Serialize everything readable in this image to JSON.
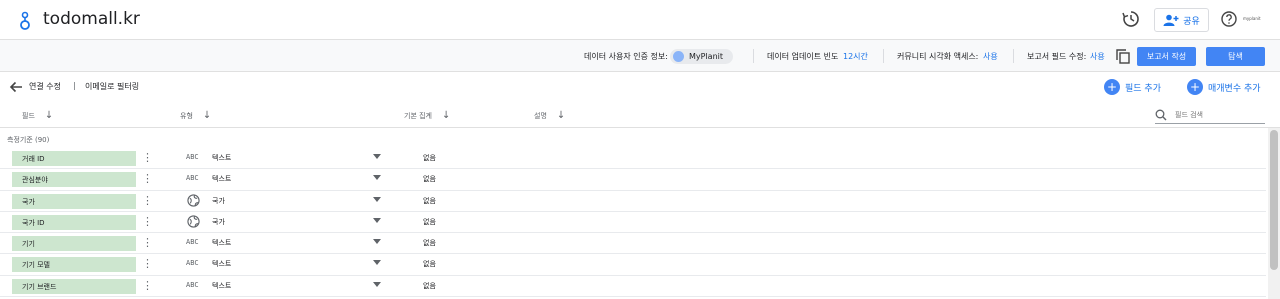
{
  "header": {
    "title": "todomall.kr",
    "share_label": "공유",
    "brand_mini": "myplanit",
    "icons": [
      "logo-icon",
      "history-icon",
      "add-person-icon",
      "help-icon"
    ]
  },
  "infobar": {
    "credentials_label": "데이터 사용자 인증 정보:",
    "credentials_user": "MyPlanit",
    "freshness_label": "데이터 업데이트 빈도",
    "freshness_value": "12시간",
    "community_label": "커뮤니티 시각화 액세스:",
    "community_value": "사용",
    "report_edit_label": "보고서 필드 수정:",
    "report_edit_value": "사용",
    "create_report_label": "보고서 작성",
    "explore_label": "탐색"
  },
  "editbar": {
    "edit_connection_label": "연결 수정",
    "separator": "|",
    "source_name": "이메일로 필터링",
    "add_field_label": "필드 추가",
    "add_parameter_label": "매개변수 추가"
  },
  "columns": {
    "field": "필드",
    "type": "유형",
    "aggregation": "기본 집계",
    "description": "설명",
    "search_placeholder": "필드 검색"
  },
  "group_label": "측정기준 (90)",
  "rows": [
    {
      "name": "거래 ID",
      "type_icon": "ABC",
      "type": "텍스트",
      "agg": "없음"
    },
    {
      "name": "관심분야",
      "type_icon": "ABC",
      "type": "텍스트",
      "agg": "없음"
    },
    {
      "name": "국가",
      "type_icon": "globe-icon",
      "type": "국가",
      "agg": "없음"
    },
    {
      "name": "국가 ID",
      "type_icon": "globe-icon",
      "type": "국가",
      "agg": "없음"
    },
    {
      "name": "기기",
      "type_icon": "ABC",
      "type": "텍스트",
      "agg": "없음"
    },
    {
      "name": "기기 모델",
      "type_icon": "ABC",
      "type": "텍스트",
      "agg": "없음"
    },
    {
      "name": "기기 브랜드",
      "type_icon": "ABC",
      "type": "텍스트",
      "agg": "없음"
    }
  ],
  "colors": {
    "accent": "#1a73e8",
    "button": "#4285f4",
    "pill": "#cde6cf"
  }
}
